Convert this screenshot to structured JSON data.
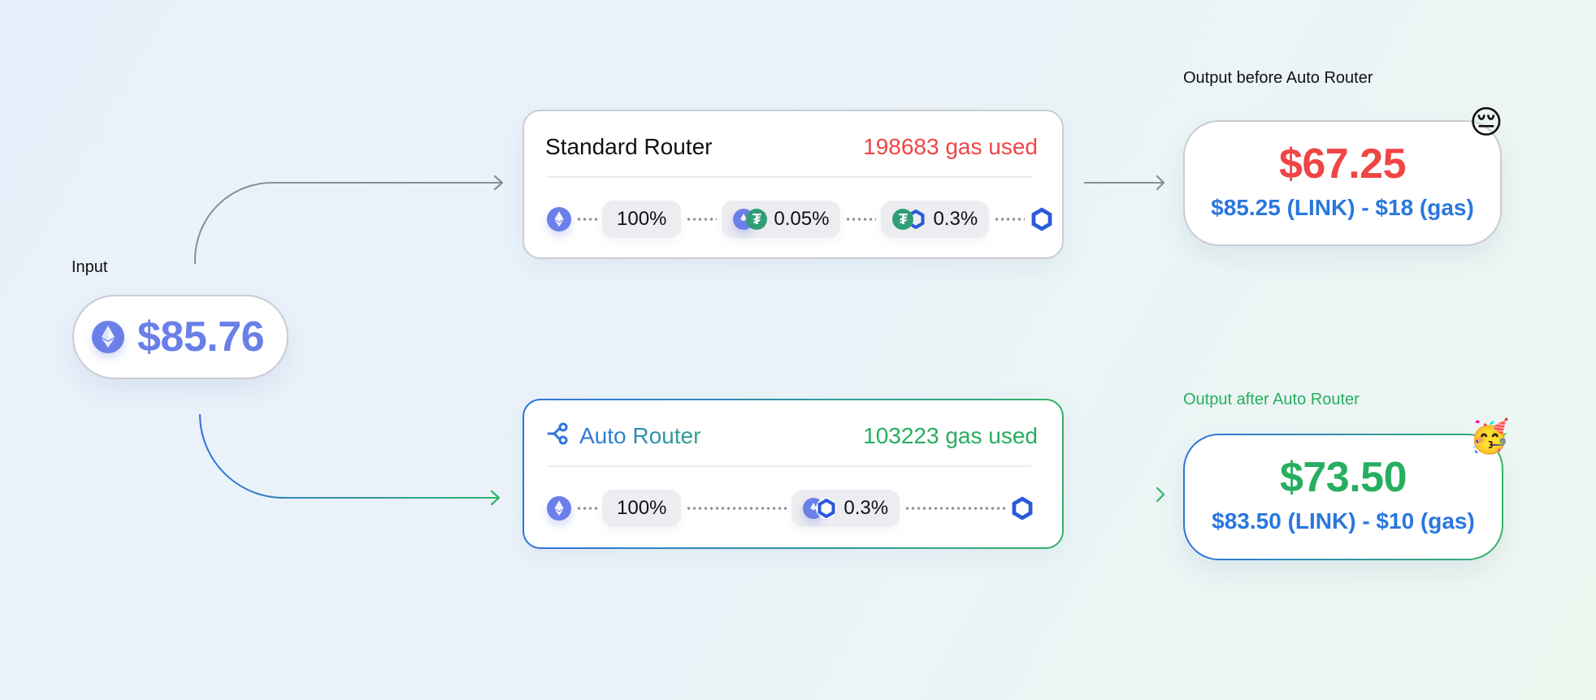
{
  "input": {
    "label": "Input",
    "token_icon": "ethereum-icon",
    "amount": "$85.76"
  },
  "standard_router": {
    "title": "Standard Router",
    "gas": "198683 gas used",
    "gas_color": "#f04545",
    "route": {
      "start_token": "ethereum-icon",
      "split_percent": "100%",
      "pools": [
        {
          "tokens": [
            "ethereum-icon",
            "tether-icon"
          ],
          "fee": "0.05%"
        },
        {
          "tokens": [
            "tether-icon",
            "chainlink-icon"
          ],
          "fee": "0.3%"
        }
      ],
      "end_token": "chainlink-icon"
    }
  },
  "auto_router": {
    "title": "Auto Router",
    "title_icon": "share-route-icon",
    "gas": "103223 gas used",
    "gas_color": "#27ae60",
    "route": {
      "start_token": "ethereum-icon",
      "split_percent": "100%",
      "pools": [
        {
          "tokens": [
            "ethereum-icon",
            "chainlink-icon"
          ],
          "fee": "0.3%"
        }
      ],
      "end_token": "chainlink-icon"
    }
  },
  "output_before": {
    "label": "Output before Auto Router",
    "amount": "$67.25",
    "breakdown": "$85.25 (LINK) - $18 (gas)",
    "emoji": "😔",
    "amount_color": "#f04545"
  },
  "output_after": {
    "label": "Output after Auto Router",
    "amount": "$73.50",
    "breakdown": "$83.50 (LINK) - $10 (gas)",
    "emoji": "🥳",
    "amount_color": "#27ae60"
  },
  "colors": {
    "accent_blue": "#2f74e0",
    "accent_green": "#35b36a",
    "eth": "#6a7fe8",
    "usdt": "#2f9e77",
    "link": "#2a5ada"
  }
}
